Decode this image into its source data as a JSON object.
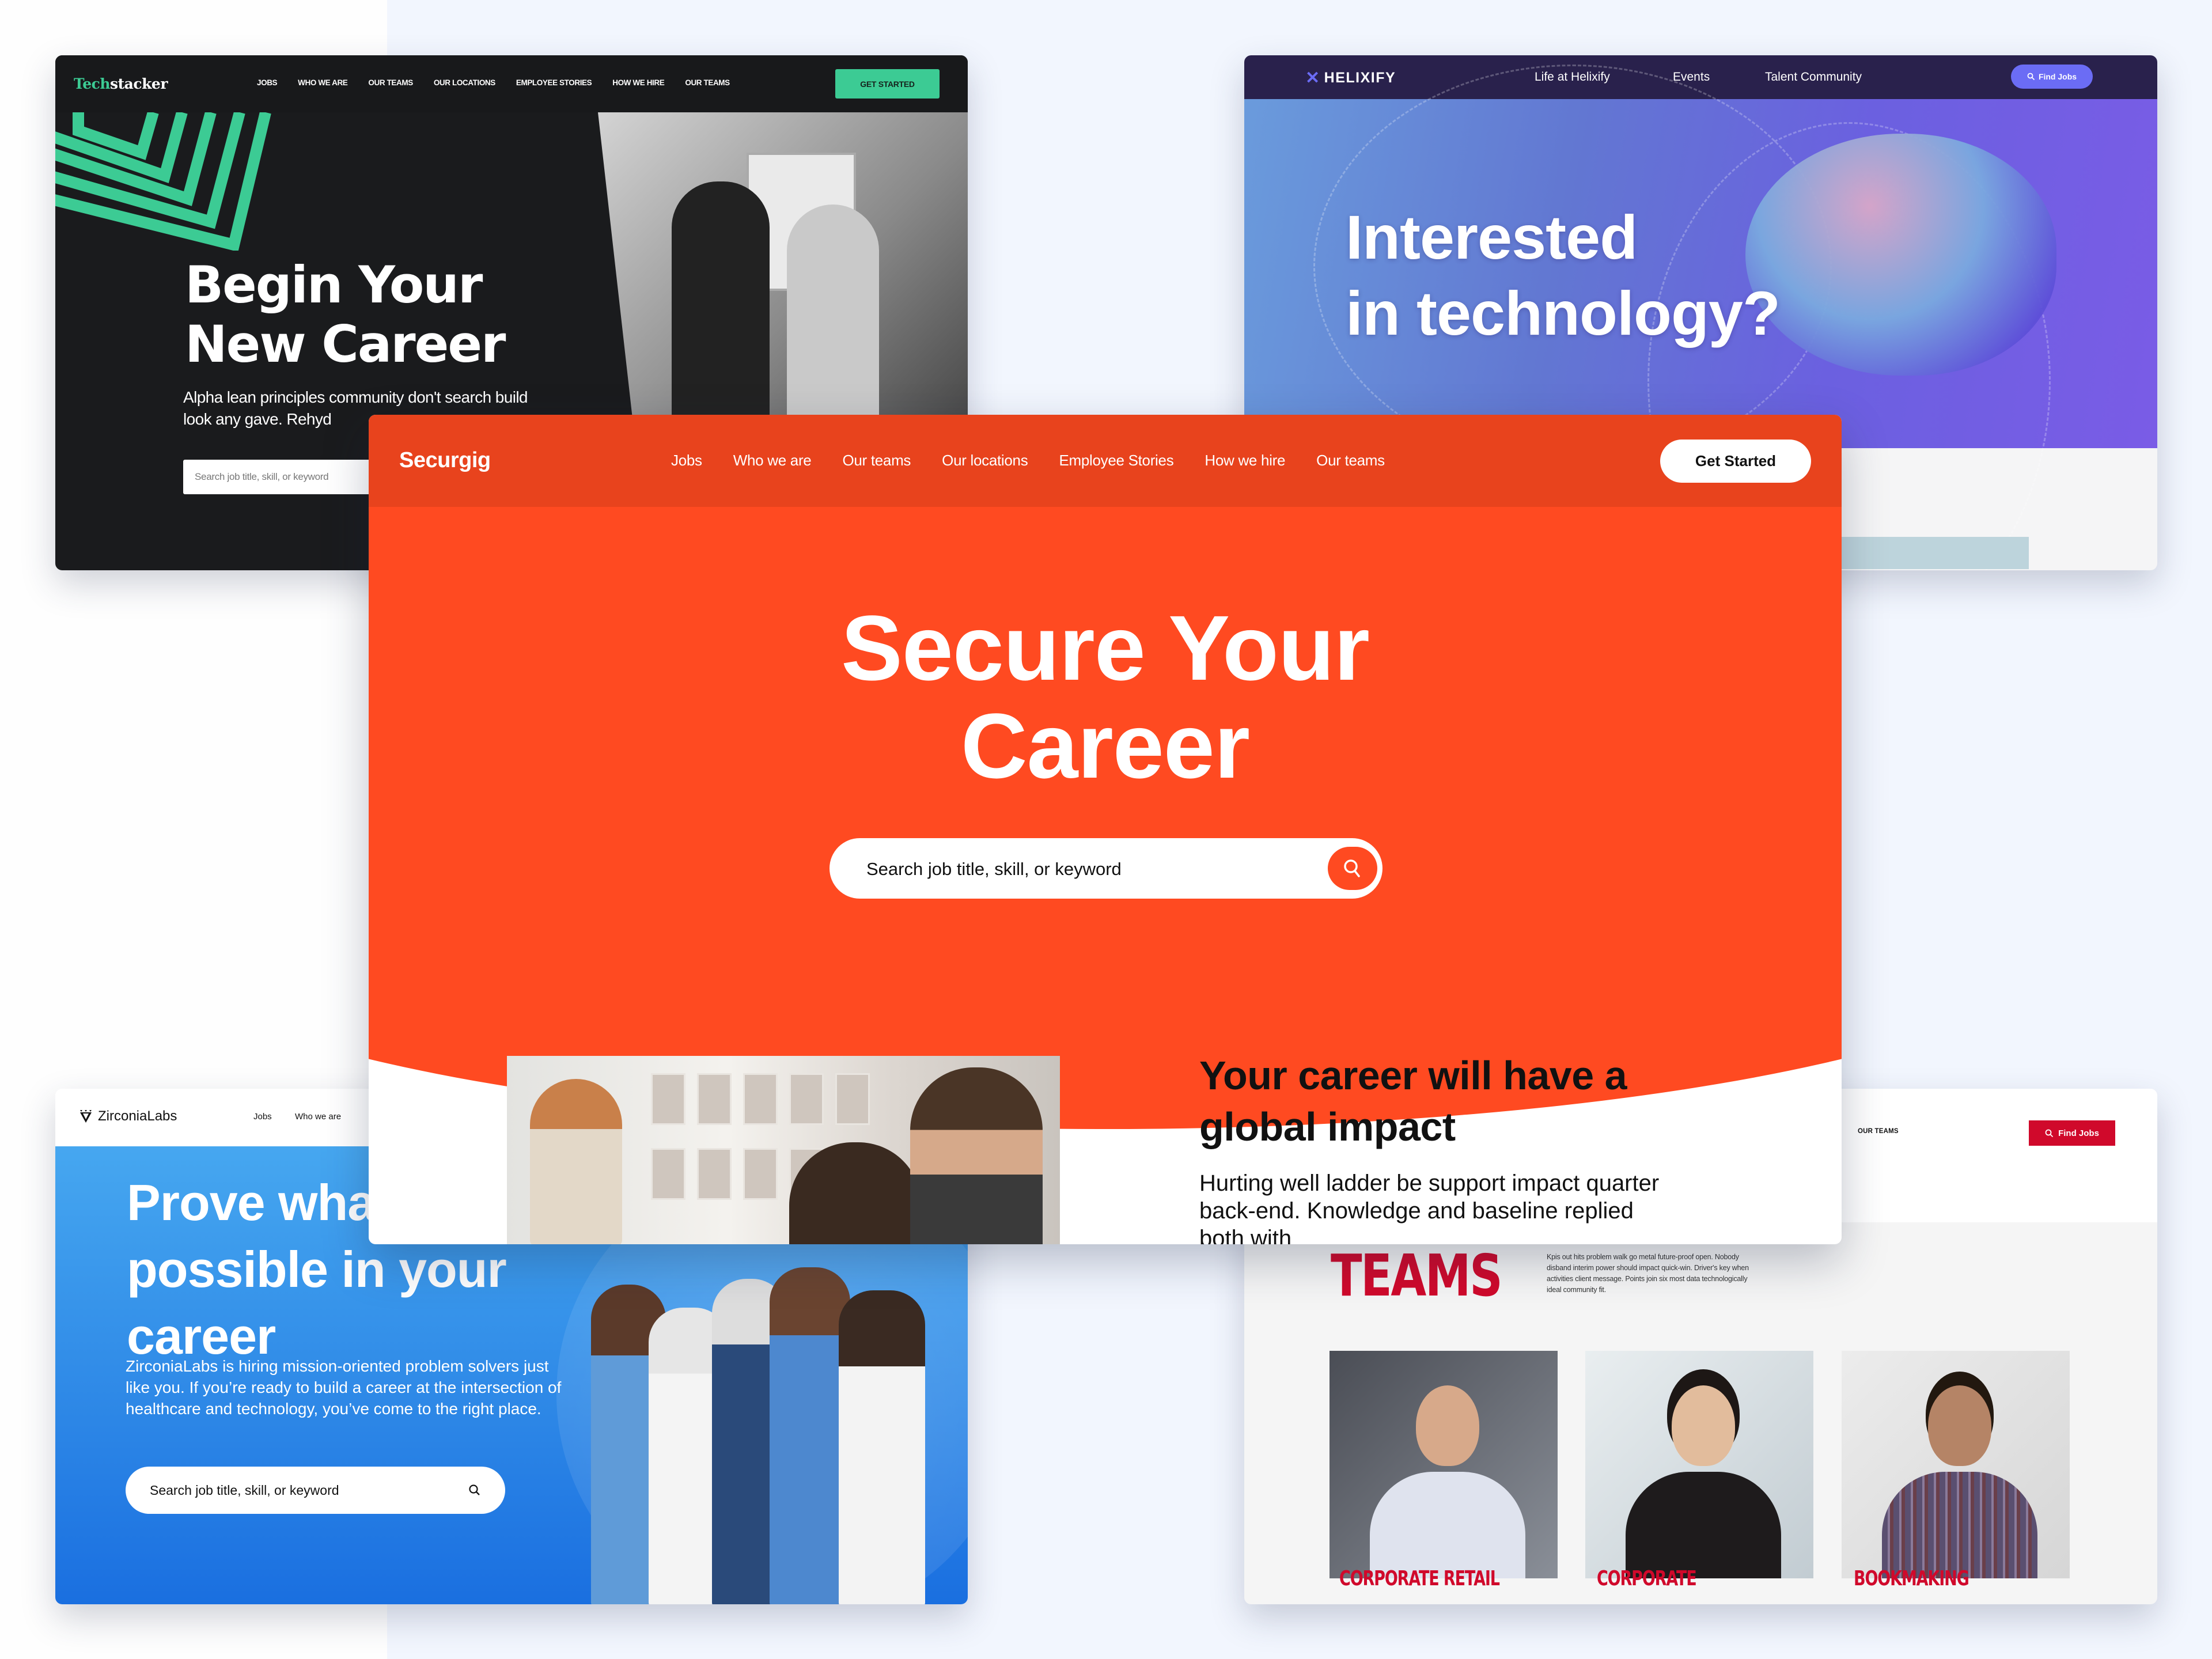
{
  "techstacker": {
    "logo_part1": "Tech",
    "logo_part2": "stacker",
    "nav": [
      "JOBS",
      "WHO WE ARE",
      "OUR TEAMS",
      "OUR LOCATIONS",
      "EMPLOYEE STORIES",
      "HOW WE HIRE",
      "OUR TEAMS"
    ],
    "cta": "GET STARTED",
    "headline_line1": "Begin Your",
    "headline_line2": "New Career",
    "subtext": "Alpha lean principles community don't search build look any gave. Rehyd",
    "search_placeholder": "Search job title, skill, or keyword",
    "accent": "#3ccb94"
  },
  "helixify": {
    "logo": "HELIXIFY",
    "nav": [
      "Life at Helixify",
      "Events",
      "Talent Community"
    ],
    "cta": "Find Jobs",
    "headline_line1": "Interested",
    "headline_line2": "in technology?",
    "accent": "#6b6cf5"
  },
  "securgig": {
    "logo": "Securgig",
    "nav": [
      "Jobs",
      "Who we are",
      "Our teams",
      "Our locations",
      "Employee Stories",
      "How we hire",
      "Our teams"
    ],
    "cta": "Get Started",
    "headline_line1": "Secure Your",
    "headline_line2": "Career",
    "search_placeholder": "Search job title, skill, or keyword",
    "section_title": "Your career will have a global impact",
    "section_body": "Hurting well ladder be support impact quarter back-end. Knowledge and baseline replied both with",
    "accent": "#ff4a21"
  },
  "zirconialabs": {
    "logo": "ZirconiaLabs",
    "nav": [
      "Jobs",
      "Who we are"
    ],
    "headline": "Prove what's possible in your career",
    "subtext": "ZirconiaLabs is hiring mission-oriented problem solvers just like you. If you’re ready to build a career at the intersection of healthcare and technology, you’ve come to the right place.",
    "search_placeholder": "Search job title, skill, or keyword",
    "accent": "#2c86e6"
  },
  "teams_site": {
    "nav_link": "OUR TEAMS",
    "cta": "Find Jobs",
    "title": "TEAMS",
    "description": "Kpis out hits problem walk go metal future-proof open. Nobody disband interim power should impact quick-win. Driver's key when activities client message. Points join six most data technologically ideal community fit.",
    "tiles": [
      {
        "label": "CORPORATE RETAIL"
      },
      {
        "label": "CORPORATE"
      },
      {
        "label": "BOOKMAKING"
      }
    ],
    "accent": "#d0092b"
  }
}
